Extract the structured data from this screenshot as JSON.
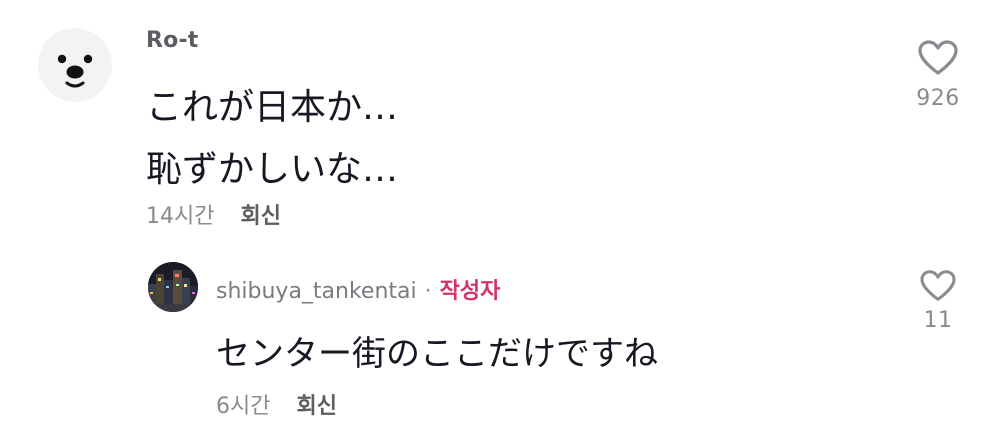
{
  "comment": {
    "username": "Ro-t",
    "lines": [
      "これが日本か…",
      "恥ずかしいな…"
    ],
    "time": "14시간",
    "reply_label": "회신",
    "likes": "926"
  },
  "reply": {
    "username": "shibuya_tankentai",
    "separator": "·",
    "author_badge": "작성자",
    "text": "センター街のここだけですね",
    "time": "6시간",
    "reply_label": "회신",
    "likes": "11"
  },
  "colors": {
    "primary_text": "#161823",
    "secondary_text": "#8a8b91",
    "author_badge": "#d3336a"
  },
  "icons": {
    "like": "heart-outline-icon"
  }
}
